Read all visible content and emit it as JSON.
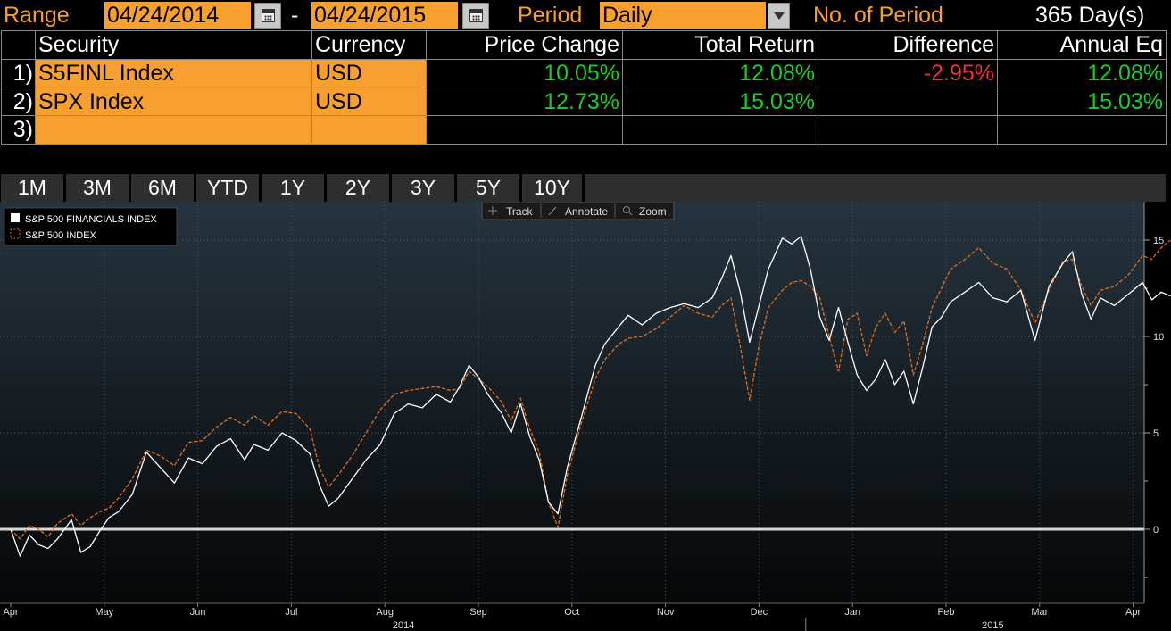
{
  "range": {
    "label": "Range",
    "start_date": "04/24/2014",
    "separator": "-",
    "end_date": "04/24/2015",
    "period_label": "Period",
    "period_value": "Daily",
    "num_period_label": "No. of Period",
    "num_period_value": "365 Day(s)"
  },
  "table": {
    "headers": [
      "Security",
      "Currency",
      "Price Change",
      "Total Return",
      "Difference",
      "Annual Eq"
    ],
    "rows": [
      {
        "idx": "1)",
        "security": "S5FINL Index",
        "currency": "USD",
        "price_change": "10.05%",
        "total_return": "12.08%",
        "difference": "-2.95%",
        "annual_eq": "12.08%"
      },
      {
        "idx": "2)",
        "security": "SPX Index",
        "currency": "USD",
        "price_change": "12.73%",
        "total_return": "15.03%",
        "difference": "",
        "annual_eq": "15.03%"
      },
      {
        "idx": "3)",
        "security": "",
        "currency": "",
        "price_change": "",
        "total_return": "",
        "difference": "",
        "annual_eq": ""
      }
    ]
  },
  "periods": [
    "1M",
    "3M",
    "6M",
    "YTD",
    "1Y",
    "2Y",
    "3Y",
    "5Y",
    "10Y"
  ],
  "toolbar": {
    "track": "Track",
    "annotate": "Annotate",
    "zoom": "Zoom"
  },
  "colors": {
    "accent_orange": "#f7a030",
    "positive": "#1ccc2a",
    "negative": "#e8333c",
    "series_1": "#ffffff",
    "series_2": "#e07020"
  },
  "chart_data": {
    "type": "line",
    "ylim": [
      -3,
      16
    ],
    "yticks": [
      0,
      5,
      10,
      15
    ],
    "xlim": [
      0,
      12.4
    ],
    "months": [
      "Apr",
      "May",
      "Jun",
      "Jul",
      "Aug",
      "Sep",
      "Oct",
      "Nov",
      "Dec",
      "Jan",
      "Feb",
      "Mar",
      "Apr"
    ],
    "years": [
      {
        "label": "2014",
        "x": 4.2
      },
      {
        "label": "2015",
        "x": 10.5
      }
    ],
    "legend_position": "top-left",
    "series": [
      {
        "name": "S&P 500 FINANCIALS INDEX",
        "color": "#ffffff",
        "dashed": false,
        "points": [
          [
            0,
            0
          ],
          [
            0.1,
            -1.4
          ],
          [
            0.2,
            -0.3
          ],
          [
            0.3,
            -0.8
          ],
          [
            0.4,
            -1.0
          ],
          [
            0.5,
            -0.5
          ],
          [
            0.65,
            0.5
          ],
          [
            0.75,
            -1.2
          ],
          [
            0.85,
            -0.9
          ],
          [
            0.95,
            -0.1
          ],
          [
            1.05,
            0.6
          ],
          [
            1.15,
            0.9
          ],
          [
            1.3,
            1.8
          ],
          [
            1.45,
            4.0
          ],
          [
            1.6,
            3.2
          ],
          [
            1.75,
            2.4
          ],
          [
            1.9,
            3.7
          ],
          [
            2.05,
            3.4
          ],
          [
            2.2,
            4.3
          ],
          [
            2.35,
            4.7
          ],
          [
            2.5,
            3.6
          ],
          [
            2.6,
            4.4
          ],
          [
            2.75,
            4.1
          ],
          [
            2.9,
            5.0
          ],
          [
            3.05,
            4.6
          ],
          [
            3.2,
            3.9
          ],
          [
            3.3,
            2.3
          ],
          [
            3.4,
            1.2
          ],
          [
            3.5,
            1.6
          ],
          [
            3.65,
            2.6
          ],
          [
            3.8,
            3.6
          ],
          [
            3.95,
            4.4
          ],
          [
            4.1,
            6.0
          ],
          [
            4.25,
            6.5
          ],
          [
            4.4,
            6.3
          ],
          [
            4.55,
            7.0
          ],
          [
            4.7,
            6.6
          ],
          [
            4.8,
            7.4
          ],
          [
            4.9,
            8.5
          ],
          [
            5.0,
            7.9
          ],
          [
            5.1,
            7.0
          ],
          [
            5.25,
            6.0
          ],
          [
            5.35,
            5.0
          ],
          [
            5.45,
            6.5
          ],
          [
            5.55,
            4.8
          ],
          [
            5.65,
            3.6
          ],
          [
            5.75,
            1.4
          ],
          [
            5.85,
            0.8
          ],
          [
            5.95,
            3.2
          ],
          [
            6.1,
            5.8
          ],
          [
            6.25,
            8.5
          ],
          [
            6.35,
            9.6
          ],
          [
            6.5,
            10.5
          ],
          [
            6.6,
            11.1
          ],
          [
            6.75,
            10.6
          ],
          [
            6.9,
            11.2
          ],
          [
            7.05,
            11.5
          ],
          [
            7.2,
            11.7
          ],
          [
            7.35,
            11.5
          ],
          [
            7.5,
            12.0
          ],
          [
            7.6,
            13.0
          ],
          [
            7.7,
            14.2
          ],
          [
            7.8,
            12.3
          ],
          [
            7.9,
            9.7
          ],
          [
            8.0,
            11.6
          ],
          [
            8.1,
            13.5
          ],
          [
            8.25,
            15.1
          ],
          [
            8.35,
            14.8
          ],
          [
            8.45,
            15.2
          ],
          [
            8.55,
            13.5
          ],
          [
            8.65,
            11.0
          ],
          [
            8.75,
            9.8
          ],
          [
            8.85,
            11.5
          ],
          [
            8.95,
            9.7
          ],
          [
            9.05,
            8.0
          ],
          [
            9.15,
            7.2
          ],
          [
            9.25,
            7.8
          ],
          [
            9.35,
            8.8
          ],
          [
            9.45,
            7.5
          ],
          [
            9.55,
            8.2
          ],
          [
            9.65,
            6.5
          ],
          [
            9.75,
            8.4
          ],
          [
            9.85,
            10.5
          ],
          [
            9.95,
            11.0
          ],
          [
            10.05,
            11.8
          ],
          [
            10.2,
            12.3
          ],
          [
            10.35,
            12.8
          ],
          [
            10.5,
            12.0
          ],
          [
            10.65,
            11.8
          ],
          [
            10.8,
            12.4
          ],
          [
            10.95,
            9.8
          ],
          [
            11.1,
            12.6
          ],
          [
            11.25,
            13.8
          ],
          [
            11.35,
            14.4
          ],
          [
            11.45,
            12.2
          ],
          [
            11.55,
            10.9
          ],
          [
            11.65,
            12.0
          ],
          [
            11.8,
            11.6
          ],
          [
            11.95,
            12.2
          ],
          [
            12.1,
            12.8
          ],
          [
            12.2,
            11.9
          ],
          [
            12.3,
            12.3
          ],
          [
            12.4,
            12.1
          ]
        ]
      },
      {
        "name": "S&P 500 INDEX",
        "color": "#e07020",
        "dashed": true,
        "points": [
          [
            0,
            0
          ],
          [
            0.1,
            -0.5
          ],
          [
            0.2,
            0.2
          ],
          [
            0.3,
            0.0
          ],
          [
            0.4,
            -0.4
          ],
          [
            0.5,
            0.3
          ],
          [
            0.65,
            0.8
          ],
          [
            0.75,
            0.2
          ],
          [
            0.85,
            0.6
          ],
          [
            0.95,
            0.9
          ],
          [
            1.05,
            1.1
          ],
          [
            1.15,
            1.6
          ],
          [
            1.3,
            2.6
          ],
          [
            1.45,
            4.1
          ],
          [
            1.6,
            3.8
          ],
          [
            1.75,
            3.3
          ],
          [
            1.9,
            4.5
          ],
          [
            2.05,
            4.6
          ],
          [
            2.2,
            5.3
          ],
          [
            2.35,
            5.8
          ],
          [
            2.5,
            5.4
          ],
          [
            2.6,
            5.9
          ],
          [
            2.75,
            5.4
          ],
          [
            2.9,
            6.1
          ],
          [
            3.05,
            6.0
          ],
          [
            3.2,
            5.2
          ],
          [
            3.3,
            3.2
          ],
          [
            3.4,
            2.2
          ],
          [
            3.5,
            2.8
          ],
          [
            3.65,
            3.8
          ],
          [
            3.8,
            5.0
          ],
          [
            3.95,
            6.2
          ],
          [
            4.1,
            7.0
          ],
          [
            4.25,
            7.2
          ],
          [
            4.4,
            7.3
          ],
          [
            4.55,
            7.4
          ],
          [
            4.7,
            7.2
          ],
          [
            4.8,
            7.3
          ],
          [
            4.9,
            8.2
          ],
          [
            5.0,
            7.8
          ],
          [
            5.1,
            7.4
          ],
          [
            5.25,
            6.6
          ],
          [
            5.35,
            5.6
          ],
          [
            5.45,
            6.8
          ],
          [
            5.55,
            5.2
          ],
          [
            5.65,
            4.0
          ],
          [
            5.75,
            1.4
          ],
          [
            5.85,
            0.1
          ],
          [
            5.95,
            2.8
          ],
          [
            6.1,
            5.5
          ],
          [
            6.25,
            7.8
          ],
          [
            6.35,
            8.8
          ],
          [
            6.5,
            9.6
          ],
          [
            6.6,
            9.9
          ],
          [
            6.75,
            10.0
          ],
          [
            6.9,
            10.4
          ],
          [
            7.05,
            11.0
          ],
          [
            7.2,
            11.6
          ],
          [
            7.35,
            11.2
          ],
          [
            7.5,
            11.0
          ],
          [
            7.6,
            11.6
          ],
          [
            7.7,
            12.0
          ],
          [
            7.8,
            9.5
          ],
          [
            7.9,
            6.7
          ],
          [
            8.0,
            9.5
          ],
          [
            8.1,
            11.5
          ],
          [
            8.25,
            12.4
          ],
          [
            8.35,
            12.8
          ],
          [
            8.45,
            12.9
          ],
          [
            8.55,
            12.6
          ],
          [
            8.65,
            12.0
          ],
          [
            8.75,
            10.0
          ],
          [
            8.85,
            8.2
          ],
          [
            8.95,
            10.9
          ],
          [
            9.05,
            11.2
          ],
          [
            9.15,
            9.0
          ],
          [
            9.25,
            10.5
          ],
          [
            9.35,
            11.2
          ],
          [
            9.45,
            10.2
          ],
          [
            9.55,
            10.8
          ],
          [
            9.65,
            8.0
          ],
          [
            9.75,
            9.6
          ],
          [
            9.85,
            11.5
          ],
          [
            9.95,
            12.5
          ],
          [
            10.05,
            13.5
          ],
          [
            10.2,
            14.0
          ],
          [
            10.35,
            14.6
          ],
          [
            10.5,
            13.8
          ],
          [
            10.65,
            13.5
          ],
          [
            10.8,
            12.4
          ],
          [
            10.95,
            10.7
          ],
          [
            11.1,
            12.4
          ],
          [
            11.25,
            13.9
          ],
          [
            11.35,
            14.0
          ],
          [
            11.45,
            12.6
          ],
          [
            11.55,
            11.6
          ],
          [
            11.65,
            12.4
          ],
          [
            11.8,
            12.6
          ],
          [
            11.95,
            13.2
          ],
          [
            12.1,
            14.2
          ],
          [
            12.2,
            14.0
          ],
          [
            12.3,
            14.6
          ],
          [
            12.4,
            15.0
          ]
        ]
      }
    ]
  }
}
